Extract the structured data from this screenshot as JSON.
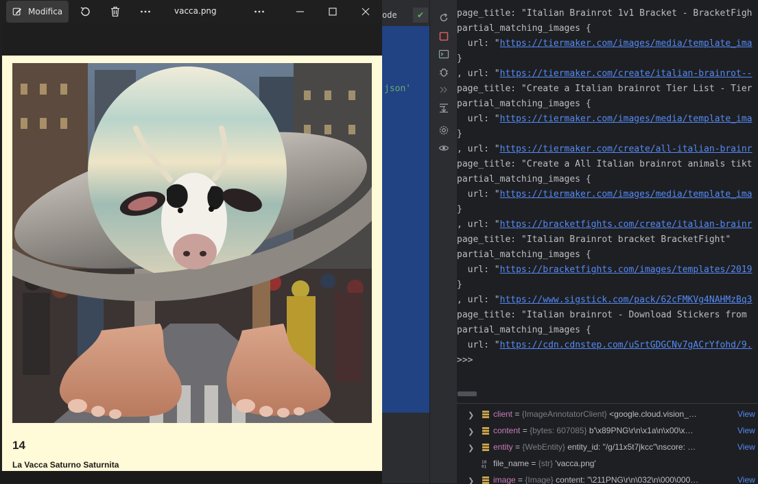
{
  "viewer": {
    "edit_label": "Modifica",
    "title": "vacca.png",
    "card_number": "14",
    "card_name": "La Vacca Saturno Saturnita"
  },
  "editor": {
    "tab_label": "ode",
    "snippet": "json'"
  },
  "console": {
    "lines": [
      {
        "pre": "page_title: \"Italian Brainrot 1v1 Bracket - BracketFigh",
        "link": "",
        "post": ""
      },
      {
        "pre": "partial_matching_images {",
        "link": "",
        "post": ""
      },
      {
        "pre": "  url: \"",
        "link": "https://tiermaker.com/images/media/template_ima",
        "post": ""
      },
      {
        "pre": "}",
        "link": "",
        "post": ""
      },
      {
        "pre": ", url: \"",
        "link": "https://tiermaker.com/create/italian-brainrot--",
        "post": ""
      },
      {
        "pre": "page_title: \"Create a Italian brainrot Tier List - Tier",
        "link": "",
        "post": ""
      },
      {
        "pre": "partial_matching_images {",
        "link": "",
        "post": ""
      },
      {
        "pre": "  url: \"",
        "link": "https://tiermaker.com/images/media/template_ima",
        "post": ""
      },
      {
        "pre": "}",
        "link": "",
        "post": ""
      },
      {
        "pre": ", url: \"",
        "link": "https://tiermaker.com/create/all-italian-brainr",
        "post": ""
      },
      {
        "pre": "page_title: \"Create a All Italian brainrot animals tikt",
        "link": "",
        "post": ""
      },
      {
        "pre": "partial_matching_images {",
        "link": "",
        "post": ""
      },
      {
        "pre": "  url: \"",
        "link": "https://tiermaker.com/images/media/template_ima",
        "post": ""
      },
      {
        "pre": "}",
        "link": "",
        "post": ""
      },
      {
        "pre": ", url: \"",
        "link": "https://bracketfights.com/create/italian-brainr",
        "post": ""
      },
      {
        "pre": "page_title: \"Italian Brainrot bracket BracketFight\"",
        "link": "",
        "post": ""
      },
      {
        "pre": "partial_matching_images {",
        "link": "",
        "post": ""
      },
      {
        "pre": "  url: \"",
        "link": "https://bracketfights.com/images/templates/2019",
        "post": ""
      },
      {
        "pre": "}",
        "link": "",
        "post": ""
      },
      {
        "pre": ", url: \"",
        "link": "https://www.sigstick.com/pack/62cFMKVg4NAHMzBq3",
        "post": ""
      },
      {
        "pre": "page_title: \"Italian brainrot - Download Stickers from",
        "link": "",
        "post": ""
      },
      {
        "pre": "partial_matching_images {",
        "link": "",
        "post": ""
      },
      {
        "pre": "  url: \"",
        "link": "https://cdn.cdnstep.com/uSrtGDGCNv7gACrYfohd/9.",
        "post": ""
      },
      {
        "pre": "}",
        "link": "",
        "post": ""
      },
      {
        "pre": ">>>",
        "link": "",
        "post": ""
      }
    ]
  },
  "variables": [
    {
      "name": "client",
      "type": "{ImageAnnotatorClient}",
      "value": "<google.cloud.vision_…",
      "view": "View",
      "expandable": true,
      "kind": "obj"
    },
    {
      "name": "content",
      "type": "{bytes: 607085}",
      "value": "b'\\x89PNG\\r\\n\\x1a\\n\\x00\\x…",
      "view": "View",
      "expandable": true,
      "kind": "obj"
    },
    {
      "name": "entity",
      "type": "{WebEntity}",
      "value": "entity_id: \"/g/11x5t7jkcc\"\\nscore: …",
      "view": "View",
      "expandable": true,
      "kind": "obj"
    },
    {
      "name": "file_name",
      "type": "{str}",
      "value": "'vacca.png'",
      "view": "",
      "expandable": false,
      "kind": "str"
    },
    {
      "name": "image",
      "type": "{Image}",
      "value": "content: \"\\211PNG\\r\\n\\032\\n\\000\\000…",
      "view": "View",
      "expandable": true,
      "kind": "obj"
    }
  ]
}
